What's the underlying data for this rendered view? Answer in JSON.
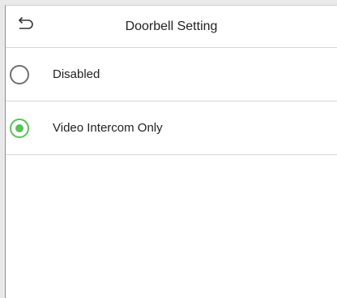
{
  "header": {
    "title": "Doorbell Setting",
    "back_icon": "back-arrow-icon"
  },
  "options": [
    {
      "label": "Disabled",
      "selected": false
    },
    {
      "label": "Video Intercom Only",
      "selected": true
    }
  ],
  "colors": {
    "accent": "#59c05a",
    "radio_border": "#6f6f6f",
    "divider": "#d6d6d6",
    "text": "#222222"
  }
}
